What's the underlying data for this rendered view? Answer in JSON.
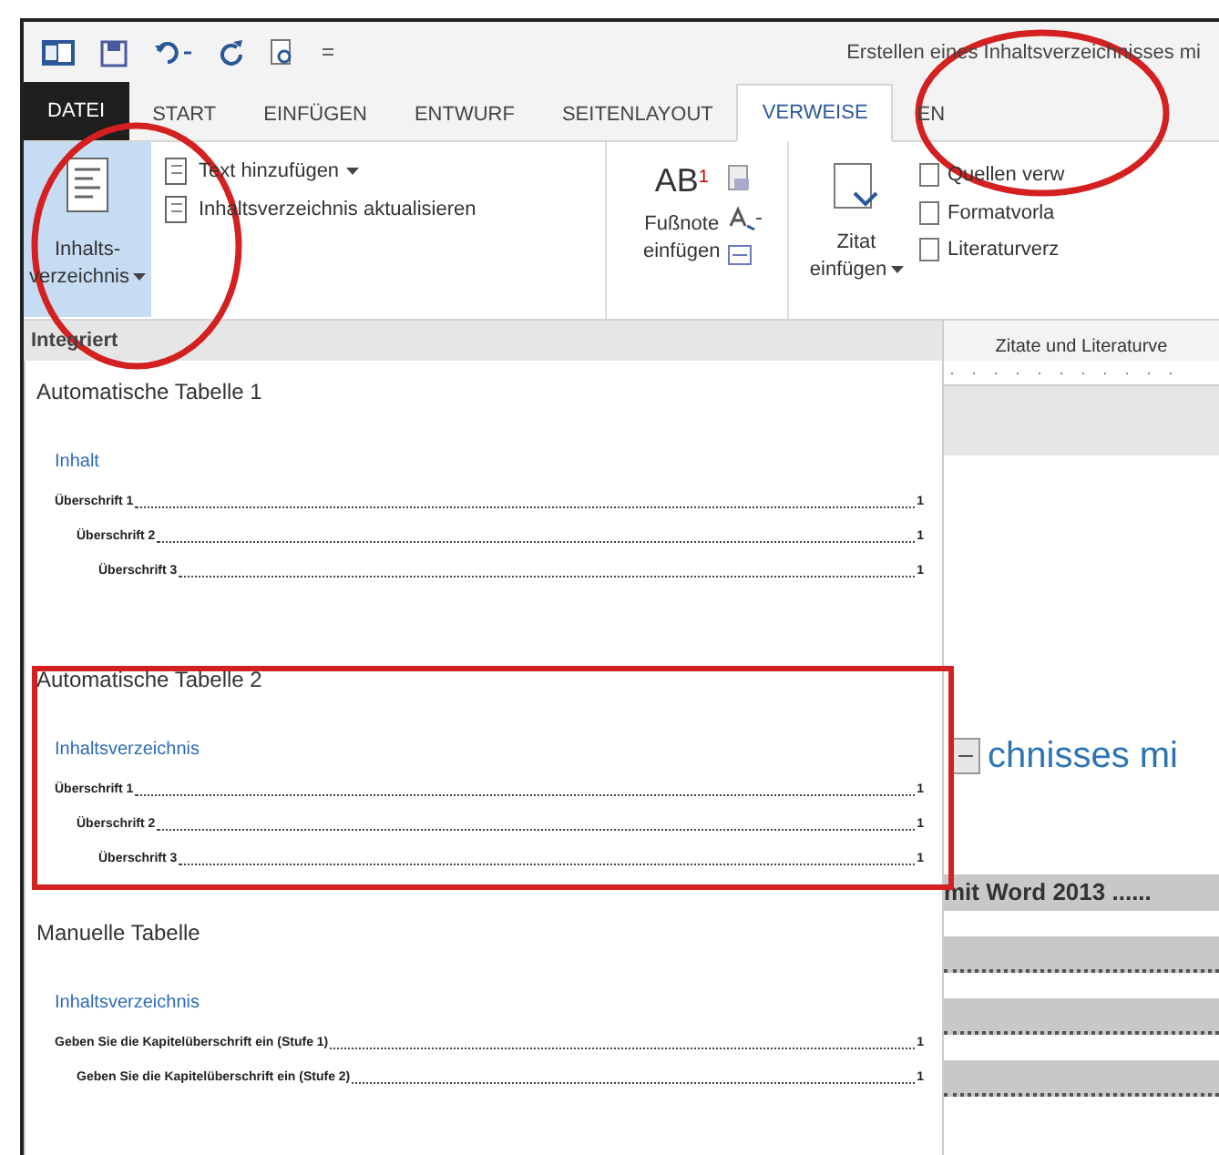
{
  "window": {
    "title": "Erstellen eines Inhaltsverzeichnisses mi"
  },
  "tabs": [
    {
      "label": "DATEI",
      "kind": "file",
      "selected": false
    },
    {
      "label": "START",
      "kind": "tab",
      "selected": false
    },
    {
      "label": "EINFÜGEN",
      "kind": "tab",
      "selected": false
    },
    {
      "label": "ENTWURF",
      "kind": "tab",
      "selected": false
    },
    {
      "label": "SEITENLAYOUT",
      "kind": "tab",
      "selected": false
    },
    {
      "label": "VERWEISE",
      "kind": "tab",
      "selected": true
    },
    {
      "label": "EN",
      "kind": "tab",
      "selected": false
    }
  ],
  "ribbon": {
    "toc_button": {
      "label": "Inhalts-",
      "label_2": "verzeichnis",
      "expanded": true
    },
    "toc_commands": [
      {
        "label": "Text hinzufügen",
        "dropdown": true
      },
      {
        "label": "Inhaltsverzeichnis aktualisieren",
        "dropdown": false
      }
    ],
    "footnote": {
      "icon_text": "AB",
      "superscript": "1",
      "label": "Fußnote",
      "label_2": "einfügen"
    },
    "citation": {
      "label": "Zitat",
      "label_2": "einfügen"
    },
    "citation_commands": [
      "Quellen verw",
      "Formatvorla",
      "Literaturverz"
    ],
    "group_label": "Zitate und Literaturve"
  },
  "gallery": {
    "header": "Integriert",
    "sections": [
      {
        "title": "Automatische Tabelle 1",
        "heading": "Inhalt",
        "entries": [
          {
            "text": "Überschrift 1",
            "page": "1",
            "children": [
              {
                "text": "Überschrift 2",
                "page": "1",
                "children": [
                  {
                    "text": "Überschrift 3",
                    "page": "1"
                  }
                ]
              }
            ]
          }
        ]
      },
      {
        "title": "Automatische Tabelle 2",
        "heading": "Inhaltsverzeichnis",
        "entries": [
          {
            "text": "Überschrift 1",
            "page": "1",
            "children": [
              {
                "text": "Überschrift 2",
                "page": "1",
                "children": [
                  {
                    "text": "Überschrift 3",
                    "page": "1"
                  }
                ]
              }
            ]
          }
        ]
      },
      {
        "title": "Manuelle Tabelle",
        "heading": "Inhaltsverzeichnis",
        "entries": [
          {
            "text": "Geben Sie die Kapitelüberschrift ein (Stufe 1)",
            "page": "1",
            "children": [
              {
                "text": "Geben Sie die Kapitelüberschrift ein (Stufe 2)",
                "page": "1"
              }
            ]
          }
        ]
      }
    ]
  },
  "document": {
    "heading": "chnisses mi",
    "toc_lines": [
      {
        "kind": "text",
        "text": "mit Word 2013 ......"
      },
      {
        "kind": "leader"
      },
      {
        "kind": "leader"
      },
      {
        "kind": "leader"
      }
    ]
  }
}
